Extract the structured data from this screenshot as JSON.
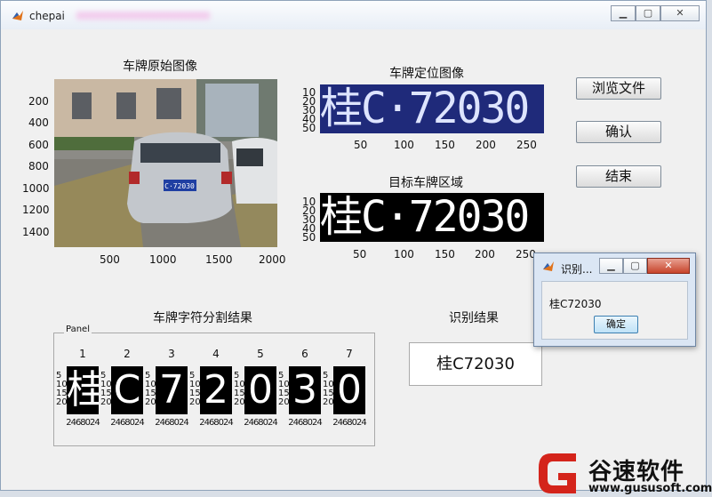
{
  "window": {
    "title": "chepai"
  },
  "axes": {
    "original": {
      "title": "车牌原始图像",
      "yticks": [
        "200",
        "400",
        "600",
        "800",
        "1000",
        "1200",
        "1400"
      ],
      "xticks": [
        "500",
        "1000",
        "1500",
        "2000"
      ],
      "plate_text": "C·72030"
    },
    "located": {
      "title": "车牌定位图像",
      "yticks": [
        "10",
        "20",
        "30",
        "40",
        "50"
      ],
      "xticks": [
        "50",
        "100",
        "150",
        "200",
        "250"
      ],
      "plate_text": "桂C·72030"
    },
    "target": {
      "title": "目标车牌区域",
      "yticks": [
        "10",
        "20",
        "30",
        "40",
        "50"
      ],
      "xticks": [
        "50",
        "100",
        "150",
        "200",
        "250"
      ],
      "plate_text": "桂C·72030"
    },
    "segmentation": {
      "title": "车牌字符分割结果",
      "panel_label": "Panel",
      "chars": [
        {
          "num": "1",
          "glyph": "桂"
        },
        {
          "num": "2",
          "glyph": "C"
        },
        {
          "num": "3",
          "glyph": "7"
        },
        {
          "num": "4",
          "glyph": "2"
        },
        {
          "num": "5",
          "glyph": "0"
        },
        {
          "num": "6",
          "glyph": "3"
        },
        {
          "num": "7",
          "glyph": "0"
        }
      ],
      "yticks": [
        "5",
        "10",
        "15",
        "20"
      ],
      "xticks": "2468024"
    }
  },
  "buttons": {
    "browse": "浏览文件",
    "confirm": "确认",
    "end": "结束"
  },
  "result": {
    "label": "识别结果",
    "value": "桂C72030"
  },
  "dialog": {
    "title": "识别...",
    "message": "桂C72030",
    "ok": "确定"
  },
  "watermark": {
    "name": "谷速软件",
    "url": "www.gususoft.com"
  }
}
